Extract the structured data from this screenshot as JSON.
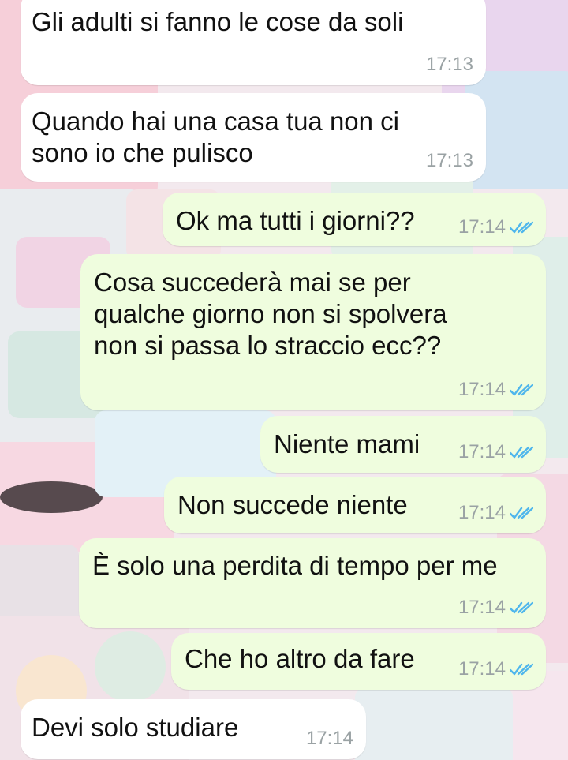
{
  "colors": {
    "incoming_bubble": "#ffffff",
    "outgoing_bubble": "#effdde",
    "message_text": "#111111",
    "timestamp": "#9aa2a4",
    "read_ticks": "#4fb6ec"
  },
  "icons": {
    "read_receipt": "double-check-icon"
  },
  "messages": [
    {
      "direction": "incoming",
      "text": "Gli adulti si fanno le cose da soli",
      "time": "17:13"
    },
    {
      "direction": "incoming",
      "text": "Quando hai una casa tua non ci\nsono io che pulisco",
      "time": "17:13"
    },
    {
      "direction": "outgoing",
      "text": "Ok ma tutti i giorni??",
      "time": "17:14",
      "status": "read"
    },
    {
      "direction": "outgoing",
      "text": "Cosa succederà mai se per\nqualche giorno non si spolvera\nnon si passa lo straccio ecc??",
      "time": "17:14",
      "status": "read"
    },
    {
      "direction": "outgoing",
      "text": "Niente mami",
      "time": "17:14",
      "status": "read"
    },
    {
      "direction": "outgoing",
      "text": "Non succede niente",
      "time": "17:14",
      "status": "read"
    },
    {
      "direction": "outgoing",
      "text": "È solo una perdita di tempo per me",
      "time": "17:14",
      "status": "read"
    },
    {
      "direction": "outgoing",
      "text": "Che ho altro da fare",
      "time": "17:14",
      "status": "read"
    },
    {
      "direction": "incoming",
      "text": "Devi solo studiare",
      "time": "17:14"
    }
  ]
}
